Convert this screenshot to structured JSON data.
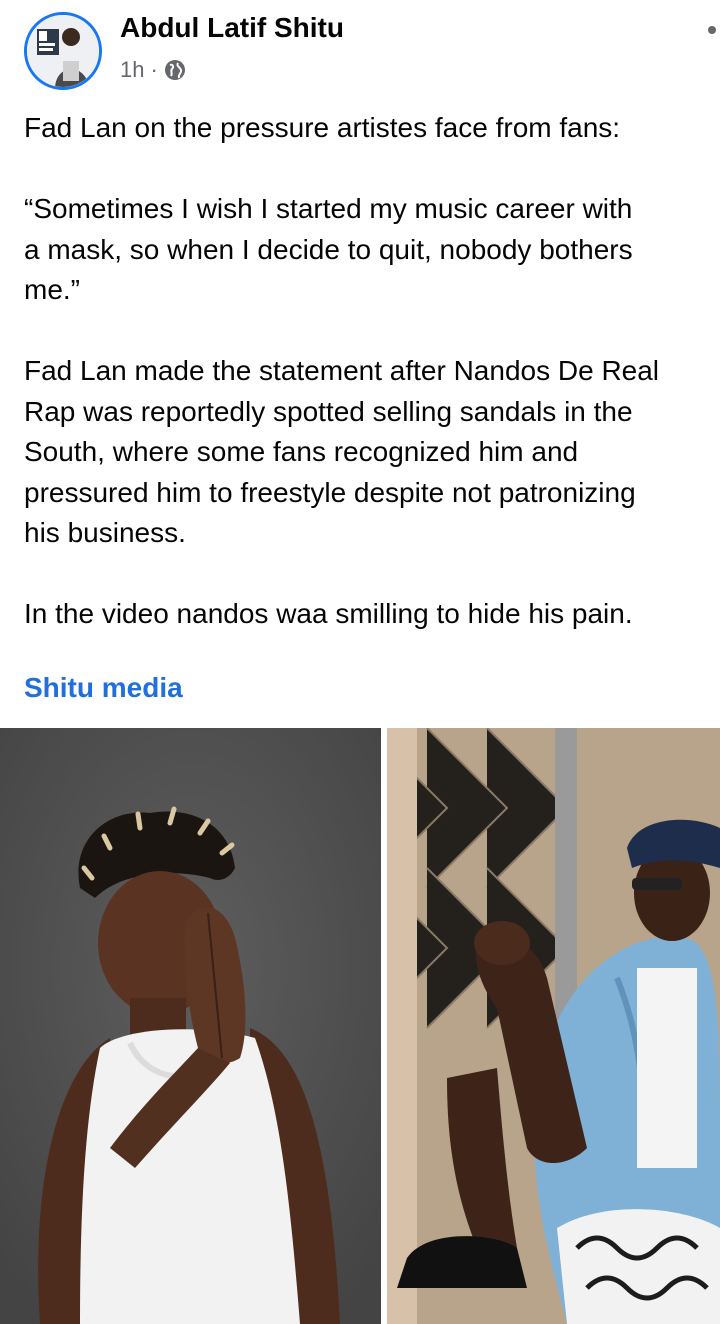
{
  "post": {
    "author": "Abdul Latif Shitu",
    "time": "1h",
    "separator": "·",
    "privacy_icon": "globe-icon",
    "paragraphs": [
      [
        "Fad Lan on the pressure artistes face from fans:"
      ],
      [
        "“Sometimes I wish I started my music career with",
        "a mask, so when I decide to quit, nobody bothers",
        "me.”"
      ],
      [
        "Fad Lan made the statement after Nandos De Real",
        "Rap was reportedly spotted selling sandals in the",
        "South, where some fans recognized him and",
        "pressured him to freestyle despite not patronizing",
        "his business."
      ],
      [
        "In the video nandos waa smilling to hide his pain."
      ]
    ],
    "page_link": "Shitu media"
  },
  "colors": {
    "link": "#216fdb",
    "meta": "#65676b",
    "text": "#050505",
    "avatar_ring": "#1877f2"
  }
}
